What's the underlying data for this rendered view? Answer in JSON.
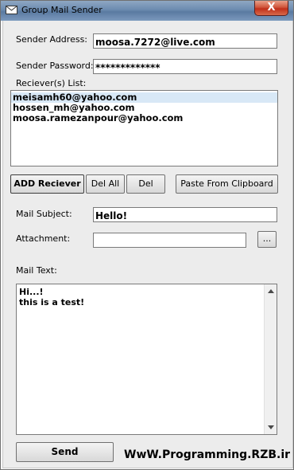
{
  "window": {
    "title": "Group Mail Sender",
    "close_symbol": "X"
  },
  "sender": {
    "address_label": "Sender Address:",
    "address_value": "moosa.7272@live.com",
    "password_label": "Sender Password:",
    "password_value": "*************"
  },
  "receivers": {
    "label": "Reciever(s) List:",
    "items": [
      "meisamh60@yahoo.com",
      "hossen_mh@yahoo.com",
      "moosa.ramezanpour@yahoo.com"
    ],
    "selected_index": 0
  },
  "buttons": {
    "add": "ADD Reciever",
    "del_all": "Del All",
    "del": "Del",
    "paste": "Paste From Clipboard",
    "browse": "...",
    "send": "Send"
  },
  "mail": {
    "subject_label": "Mail Subject:",
    "subject_value": "Hello!",
    "attachment_label": "Attachment:",
    "attachment_value": "",
    "text_label": "Mail Text:",
    "text_value": "Hi...!\nthis is a test!"
  },
  "watermark": "WwW.Programming.RZB.ir",
  "colors": {
    "selection": "#d8e8f6",
    "titlebar": "#6c8bb0",
    "close": "#c0301a"
  }
}
